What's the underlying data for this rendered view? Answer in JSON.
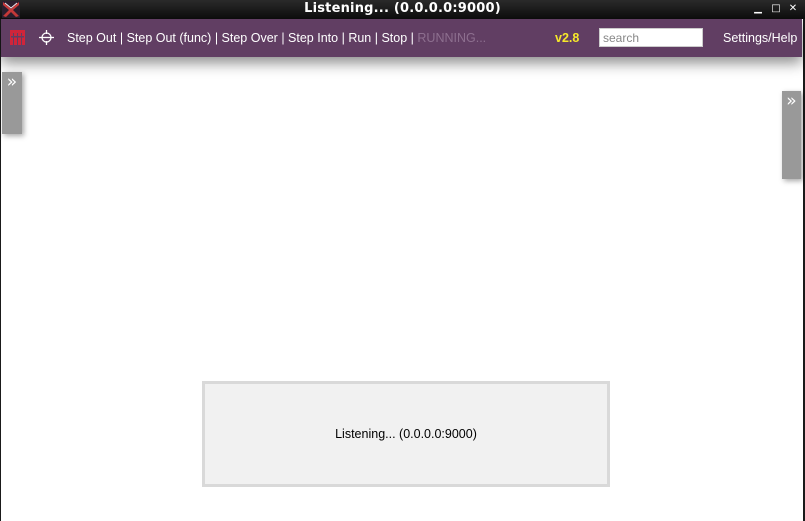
{
  "window": {
    "title": "Listening... (0.0.0.0:9000)",
    "minimize_glyph": "▁",
    "maximize_glyph": "□",
    "close_glyph": "✕"
  },
  "toolbar": {
    "logo_icon": "app-logo-icon",
    "target_icon": "crosshair-icon",
    "actions": [
      {
        "label": "Step Out"
      },
      {
        "label": "Step Out (func)"
      },
      {
        "label": "Step Over"
      },
      {
        "label": "Step Into"
      },
      {
        "label": "Run"
      },
      {
        "label": "Stop"
      }
    ],
    "separator": "|",
    "status": "RUNNING...",
    "version": "v2.8",
    "search_placeholder": "search",
    "search_value": "",
    "settings_label": "Settings/Help",
    "colors": {
      "background": "#613e63",
      "version": "#f6e82a",
      "status_dim": "#8d6f8f"
    }
  },
  "side_panels": {
    "left_toggle": "»",
    "right_toggle": "»"
  },
  "status_box": {
    "message": "Listening... (0.0.0.0:9000)"
  }
}
